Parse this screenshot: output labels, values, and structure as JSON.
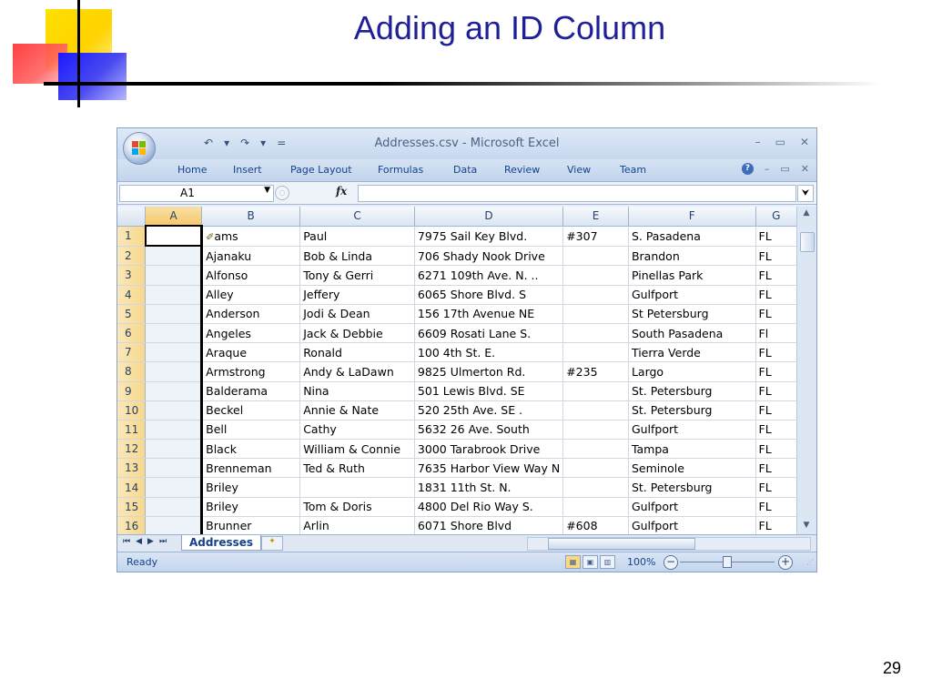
{
  "slide": {
    "title": "Adding an ID Column",
    "page_number": "29"
  },
  "window": {
    "title": "Addresses.csv - Microsoft Excel",
    "controls": [
      "–",
      "▭",
      "✕"
    ],
    "qat": [
      "↶",
      "▾",
      "↷",
      "▾",
      "="
    ]
  },
  "ribbon": {
    "tabs": [
      "Home",
      "Insert",
      "Page Layout",
      "Formulas",
      "Data",
      "Review",
      "View",
      "Team"
    ],
    "controls": [
      "–",
      "▭",
      "✕"
    ]
  },
  "formula_bar": {
    "name_box": "A1",
    "fx": "fx",
    "value": ""
  },
  "sheet": {
    "columns": [
      "A",
      "B",
      "C",
      "D",
      "E",
      "F",
      "G"
    ],
    "rows": [
      {
        "n": "1",
        "A": "",
        "B": "ams",
        "C": "Paul",
        "D": "7975 Sail Key Blvd.",
        "E": "#307",
        "F": "S. Pasadena",
        "G": "FL"
      },
      {
        "n": "2",
        "A": "",
        "B": "Ajanaku",
        "C": "Bob & Linda",
        "D": "706 Shady Nook Drive",
        "E": "",
        "F": "Brandon",
        "G": "FL"
      },
      {
        "n": "3",
        "A": "",
        "B": "Alfonso",
        "C": "Tony & Gerri",
        "D": "6271 109th Ave. N. ..",
        "E": "",
        "F": "Pinellas Park",
        "G": "FL"
      },
      {
        "n": "4",
        "A": "",
        "B": "Alley",
        "C": "Jeffery",
        "D": "6065 Shore Blvd. S",
        "E": "",
        "F": "Gulfport",
        "G": "FL"
      },
      {
        "n": "5",
        "A": "",
        "B": "Anderson",
        "C": "Jodi & Dean",
        "D": "156 17th Avenue NE",
        "E": "",
        "F": "St Petersburg",
        "G": "FL"
      },
      {
        "n": "6",
        "A": "",
        "B": "Angeles",
        "C": "Jack & Debbie",
        "D": "6609 Rosati Lane S.",
        "E": "",
        "F": "South Pasadena",
        "G": "Fl"
      },
      {
        "n": "7",
        "A": "",
        "B": "Araque",
        "C": "Ronald",
        "D": "100 4th St. E.",
        "E": "",
        "F": "Tierra Verde",
        "G": "FL"
      },
      {
        "n": "8",
        "A": "",
        "B": "Armstrong",
        "C": "Andy & LaDawn",
        "D": "9825 Ulmerton Rd.",
        "E": "#235",
        "F": "Largo",
        "G": "FL"
      },
      {
        "n": "9",
        "A": "",
        "B": "Balderama",
        "C": "Nina",
        "D": "501 Lewis Blvd. SE",
        "E": "",
        "F": "St. Petersburg",
        "G": "FL"
      },
      {
        "n": "10",
        "A": "",
        "B": "Beckel",
        "C": "Annie & Nate",
        "D": "520 25th Ave. SE .",
        "E": "",
        "F": "St. Petersburg",
        "G": "FL"
      },
      {
        "n": "11",
        "A": "",
        "B": "Bell",
        "C": "Cathy",
        "D": "5632 26 Ave. South",
        "E": "",
        "F": "Gulfport",
        "G": "FL"
      },
      {
        "n": "12",
        "A": "",
        "B": "Black",
        "C": "William & Connie",
        "D": "3000 Tarabrook Drive",
        "E": "",
        "F": "Tampa",
        "G": "FL"
      },
      {
        "n": "13",
        "A": "",
        "B": "Brenneman",
        "C": "Ted & Ruth",
        "D": "7635 Harbor View Way N",
        "E": "",
        "F": "Seminole",
        "G": "FL"
      },
      {
        "n": "14",
        "A": "",
        "B": "Briley",
        "C": "",
        "D": "1831 11th St. N.",
        "E": "",
        "F": "St. Petersburg",
        "G": "FL"
      },
      {
        "n": "15",
        "A": "",
        "B": "Briley",
        "C": "Tom & Doris",
        "D": "4800 Del Rio Way S.",
        "E": "",
        "F": "Gulfport",
        "G": "FL"
      },
      {
        "n": "16",
        "A": "",
        "B": "Brunner",
        "C": "Arlin",
        "D": "6071 Shore Blvd",
        "E": "#608",
        "F": "Gulfport",
        "G": "FL"
      }
    ],
    "tab_name": "Addresses",
    "nav": [
      "⏮",
      "◀",
      "▶",
      "⏭"
    ]
  },
  "status": {
    "text": "Ready",
    "zoom": "100%"
  },
  "colors": {
    "title": "#1f1f99",
    "ribbon_text": "#15428b",
    "row_header": "#f7d88c"
  }
}
